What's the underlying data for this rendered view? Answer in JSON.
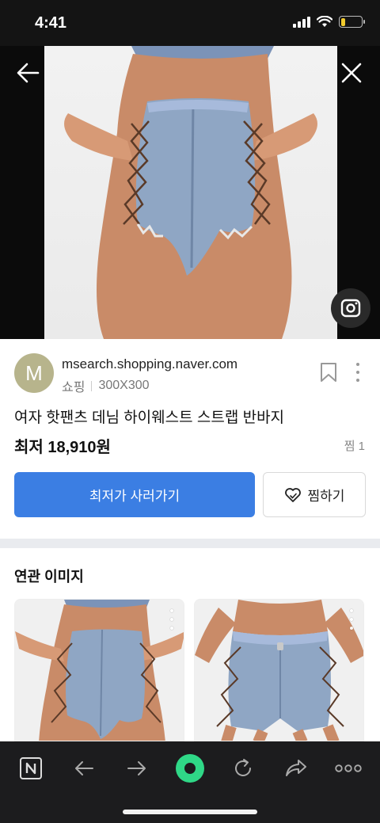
{
  "status_bar": {
    "time": "4:41",
    "battery_level": 0.2,
    "battery_color": "#f2cb2d"
  },
  "viewer": {
    "icons": {
      "back": "arrow-left-icon",
      "close": "close-icon",
      "lens": "lens-search-icon"
    }
  },
  "source": {
    "avatar_letter": "M",
    "domain": "msearch.shopping.naver.com",
    "category": "쇼핑",
    "size": "300X300"
  },
  "product": {
    "title": "여자 핫팬츠 데님 하이웨스트 스트랩 반바지",
    "price": "최저 18,910원",
    "wish_count": "찜 1",
    "buy_label": "최저가 사러가기",
    "wish_label": "찜하기"
  },
  "related": {
    "title": "연관 이미지"
  },
  "toolbar": {
    "icons": [
      "naver-home-icon",
      "back-arrow-icon",
      "forward-arrow-icon",
      "green-dot-icon",
      "refresh-icon",
      "share-icon",
      "more-horizontal-icon"
    ]
  },
  "colors": {
    "accent": "#3b7ee3",
    "green": "#2fd887",
    "toolbar_bg": "#1c1c1e"
  }
}
